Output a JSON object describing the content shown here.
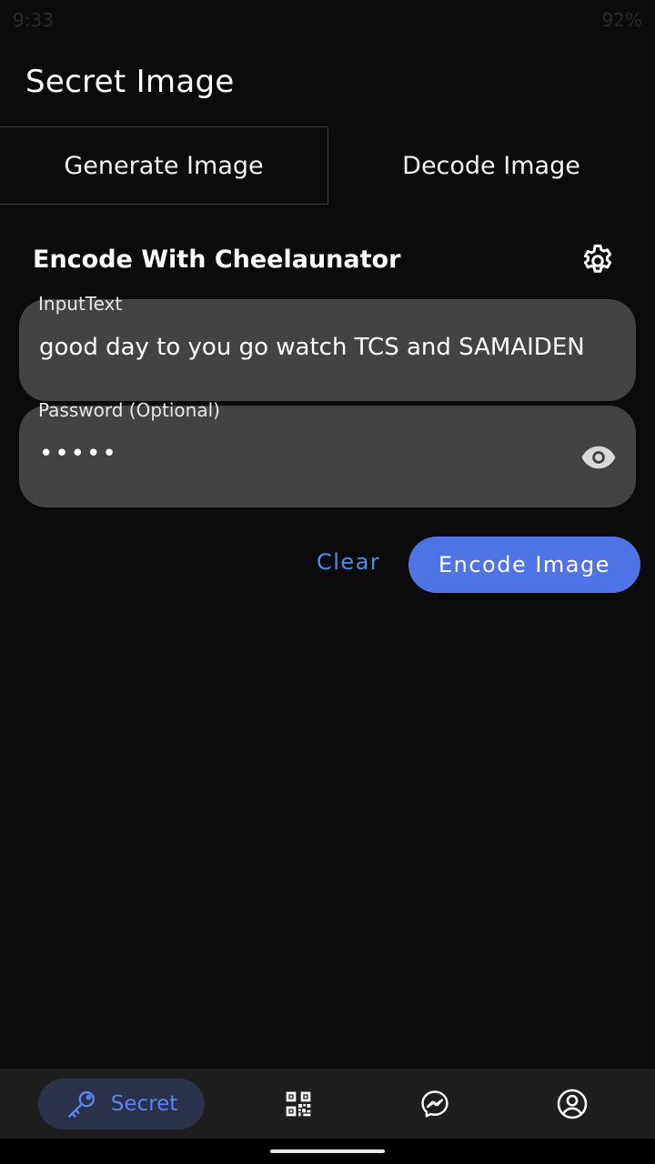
{
  "status_bar": {
    "time": "9:33",
    "battery": "92%"
  },
  "app": {
    "title": "Secret Image"
  },
  "tabs": [
    {
      "label": "Generate Image",
      "active": true
    },
    {
      "label": "Decode Image",
      "active": false
    }
  ],
  "section": {
    "title": "Encode With Cheelaunator"
  },
  "input_text": {
    "label": "InputText",
    "value": "good day to you go watch TCS and SAMAIDEN"
  },
  "password": {
    "label": "Password (Optional)",
    "value": "•••••"
  },
  "actions": {
    "clear_label": "Clear",
    "encode_label": "Encode Image"
  },
  "bottom_nav": {
    "items": [
      {
        "label": "Secret",
        "icon": "key-icon",
        "active": true
      },
      {
        "label": "",
        "icon": "qr-code-icon",
        "active": false
      },
      {
        "label": "",
        "icon": "messenger-icon",
        "active": false
      },
      {
        "label": "",
        "icon": "profile-icon",
        "active": false
      }
    ]
  },
  "colors": {
    "accent": "#4f74e6",
    "link": "#4f8fe3",
    "field_bg": "#434343",
    "background": "#0b0b0b"
  }
}
